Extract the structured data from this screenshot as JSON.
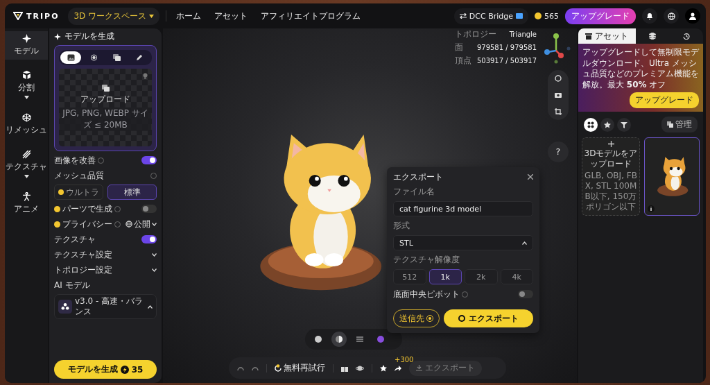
{
  "topbar": {
    "logo": "TRIPO",
    "workspace": "3D ワークスペース",
    "nav": [
      {
        "label": "ホーム"
      },
      {
        "label": "アセット"
      },
      {
        "label": "アフィリエイトプログラム"
      }
    ],
    "dcc": "DCC Bridge",
    "credits": "565",
    "upgrade": "アップグレード"
  },
  "rail": [
    {
      "label": "モデル",
      "selected": true,
      "caret": false
    },
    {
      "label": "分割",
      "selected": false,
      "caret": true
    },
    {
      "label": "リメッシュ",
      "selected": false,
      "caret": false
    },
    {
      "label": "テクスチャ",
      "selected": false,
      "caret": true
    },
    {
      "label": "アニメ",
      "selected": false,
      "caret": false
    }
  ],
  "generate_panel": {
    "title": "モデルを生成",
    "input_tabs": [
      {
        "selected": true
      },
      {
        "selected": false
      },
      {
        "selected": false
      },
      {
        "selected": false
      }
    ],
    "upload": {
      "label": "アップロード",
      "hint": "JPG, PNG, WEBP サイズ ≤ 20MB"
    },
    "enhance": {
      "label": "画像を改善",
      "on": true
    },
    "mesh_quality": {
      "label": "メッシュ品質",
      "options": [
        {
          "label": "ウルトラ",
          "premium": true,
          "selected": false
        },
        {
          "label": "標準",
          "premium": false,
          "selected": true
        }
      ]
    },
    "parts": {
      "label": "パーツで生成",
      "on": false
    },
    "privacy": {
      "label": "プライバシー",
      "value": "公開"
    },
    "texture": {
      "label": "テクスチャ",
      "on": true
    },
    "collapsibles": [
      {
        "label": "テクスチャ設定"
      },
      {
        "label": "トポロジー設定"
      }
    ],
    "ai_model": {
      "label": "AI モデル",
      "value": "v3.0 - 高速・バランス"
    },
    "generate": {
      "label": "モデルを生成",
      "cost": "35"
    }
  },
  "stats": [
    {
      "label": "トポロジー",
      "value": "Triangle"
    },
    {
      "label": "面",
      "value": "979581 / 979581"
    },
    {
      "label": "頂点",
      "value": "503917 / 503917"
    }
  ],
  "export_dialog": {
    "title": "エクスポート",
    "filename_label": "ファイル名",
    "filename": "cat figurine 3d model",
    "format_label": "形式",
    "format": "STL",
    "resolution_label": "テクスチャ解像度",
    "resolutions": [
      {
        "label": "512",
        "selected": false
      },
      {
        "label": "1k",
        "selected": true
      },
      {
        "label": "2k",
        "selected": false
      },
      {
        "label": "4k",
        "selected": false
      }
    ],
    "pivot": {
      "label": "底面中央ピボット",
      "on": false
    },
    "send": "送信先",
    "export": "エクスポート"
  },
  "view_modes": [
    {
      "selected": false
    },
    {
      "selected": true
    },
    {
      "selected": false
    },
    {
      "selected": false
    }
  ],
  "bottom_toolbar": {
    "retry": "無料再試行",
    "share_bonus": "+300",
    "export": {
      "label": "エクスポート",
      "disabled": true
    }
  },
  "help": "?",
  "assets_panel": {
    "tabs": [
      {
        "label": "アセット",
        "selected": true
      },
      {
        "selected": false
      },
      {
        "selected": false
      }
    ],
    "promo": {
      "text": "アップグレードして無制限モデルダウンロード、Ultra メッシュ品質などのプレミアム機能を解放。最大 **50%** オフ",
      "button": "アップグレード"
    },
    "filters": [
      {
        "selected": true
      },
      {
        "selected": false
      },
      {
        "selected": false
      }
    ],
    "manage": "管理",
    "upload_card": {
      "title": "3Dモデルをアップロード",
      "hint": "GLB, OBJ, FBX, STL 100MB以下, 150万ポリゴン以下"
    }
  }
}
